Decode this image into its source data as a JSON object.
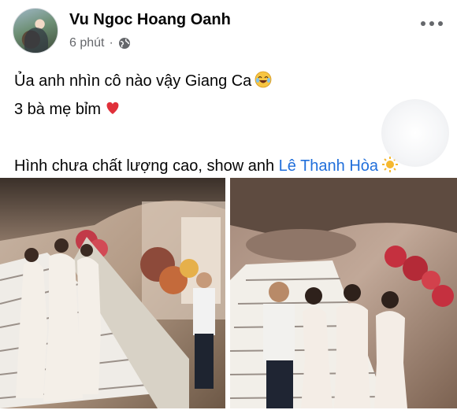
{
  "post": {
    "author": "Vu Ngoc Hoang Oanh",
    "time": "6 phút",
    "separator": "·",
    "privacy_icon": "globe-icon",
    "more_icon": "more-options-icon",
    "lines": {
      "line1_text": "Ủa anh nhìn cô nào vậy Giang Ca",
      "line1_emoji": "laughing-crying-emoji",
      "line2_text": "3 bà mẹ bỉm",
      "line2_emoji": "red-heart-emoji",
      "line3_text": "Hình chưa chất lượng cao, show anh ",
      "line3_mention": "Lê Thanh Hòa",
      "line3_emoji": "sun-emoji"
    },
    "photos": [
      {
        "name": "event-photo-left"
      },
      {
        "name": "event-photo-right"
      }
    ],
    "colors": {
      "mention": "#216fdb",
      "meta": "#65676b",
      "text": "#050505"
    }
  }
}
